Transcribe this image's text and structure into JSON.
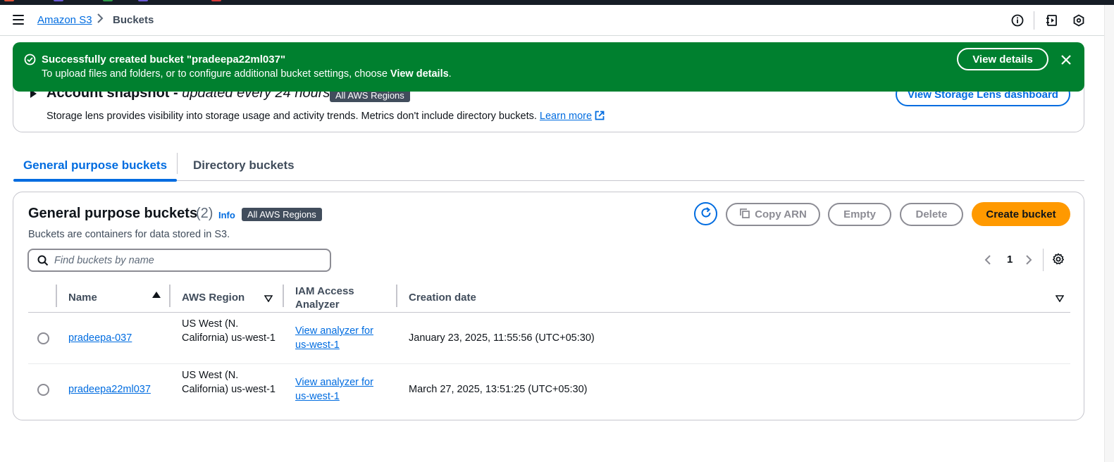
{
  "colors": {
    "accent": "#006ce0",
    "success": "#00802f",
    "primary_button": "#ff9900",
    "badge": "#414d5c"
  },
  "topbar": {
    "menu_icon": "hamburger-icon",
    "breadcrumb": {
      "service": "Amazon S3",
      "current": "Buckets"
    },
    "icons": [
      "info-icon",
      "notes-icon",
      "settings-hex-icon"
    ]
  },
  "flash": {
    "title": "Successfully created bucket \"pradeepa22ml037\"",
    "message_prefix": "To upload files and folders, or to configure additional bucket settings, choose ",
    "message_bold": "View details",
    "message_suffix": ".",
    "button": "View details"
  },
  "snapshot": {
    "title": "Account snapshot - ",
    "title_italic": "updated every 24 hours",
    "badge": "All AWS Regions",
    "description": "Storage lens provides visibility into storage usage and activity trends. Metrics don't include directory buckets. ",
    "learn_more": "Learn more",
    "button": "View Storage Lens dashboard"
  },
  "tabs": [
    "General purpose buckets",
    "Directory buckets"
  ],
  "panel": {
    "title": "General purpose buckets",
    "count": "(2)",
    "info": "Info",
    "badge": "All AWS Regions",
    "description": "Buckets are containers for data stored in S3.",
    "buttons": {
      "copy_arn": "Copy ARN",
      "empty": "Empty",
      "delete": "Delete",
      "create": "Create bucket"
    },
    "search_placeholder": "Find buckets by name",
    "page": "1",
    "columns": [
      "Name",
      "AWS Region",
      "IAM Access Analyzer",
      "Creation date"
    ],
    "rows": [
      {
        "name": "pradeepa-037",
        "region": "US West (N. California) us-west-1",
        "analyzer": "View analyzer for us-west-1",
        "created": "January 23, 2025, 11:55:56 (UTC+05:30)"
      },
      {
        "name": "pradeepa22ml037",
        "region": "US West (N. California) us-west-1",
        "analyzer": "View analyzer for us-west-1",
        "created": "March 27, 2025, 13:51:25 (UTC+05:30)"
      }
    ]
  }
}
